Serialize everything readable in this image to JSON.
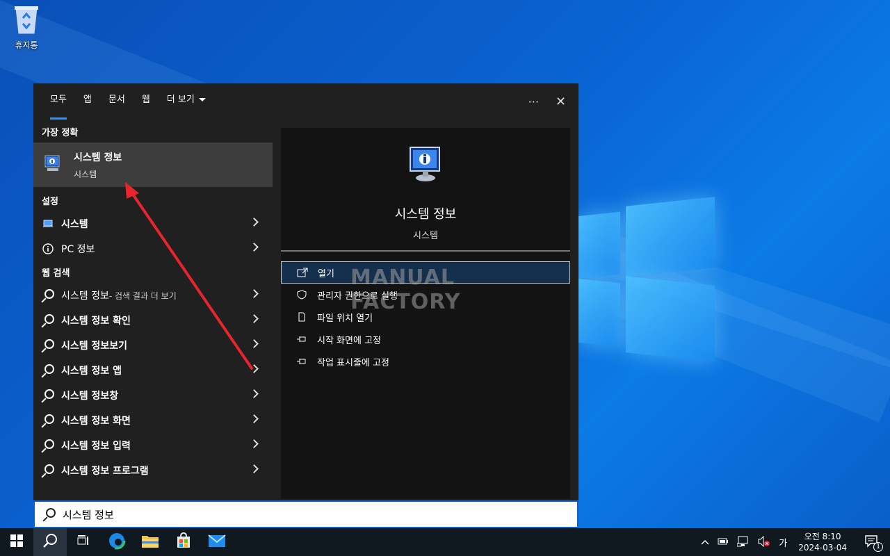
{
  "desktop": {
    "recycle_bin_label": "휴지통"
  },
  "tabs": [
    {
      "label": "모두"
    },
    {
      "label": "앱"
    },
    {
      "label": "문서"
    },
    {
      "label": "웹"
    },
    {
      "label": "더 보기"
    }
  ],
  "tools": {
    "more": "···",
    "close": "✕"
  },
  "best_match": {
    "heading": "가장 정확",
    "title": "시스템 정보",
    "subtitle": "시스템"
  },
  "settings": {
    "heading": "설정",
    "items": [
      {
        "label": "시스템"
      },
      {
        "label": "PC 정보"
      }
    ]
  },
  "web": {
    "heading": "웹 검색",
    "items": [
      {
        "label": "시스템 정보",
        "sub": " - 검색 결과 더 보기"
      },
      {
        "label": "시스템 정보 확인"
      },
      {
        "label": "시스템 정보보기"
      },
      {
        "label": "시스템 정보 앱"
      },
      {
        "label": "시스템 정보창"
      },
      {
        "label": "시스템 정보 화면"
      },
      {
        "label": "시스템 정보 입력"
      },
      {
        "label": "시스템 정보 프로그램"
      }
    ]
  },
  "preview": {
    "title": "시스템 정보",
    "subtitle": "시스템",
    "actions": [
      {
        "label": "열기"
      },
      {
        "label": "관리자 권한으로 실행"
      },
      {
        "label": "파일 위치 열기"
      },
      {
        "label": "시작 화면에 고정"
      },
      {
        "label": "작업 표시줄에 고정"
      }
    ]
  },
  "watermark": "MANUAL FACTORY",
  "search": {
    "value": "시스템 정보"
  },
  "taskbar": {
    "ime": "가",
    "time": "오전 8:10",
    "date": "2024-03-04",
    "notifications": "1"
  },
  "colors": {
    "accent": "#3b8eea",
    "panel": "#202020",
    "selected": "#3d3d3d"
  }
}
